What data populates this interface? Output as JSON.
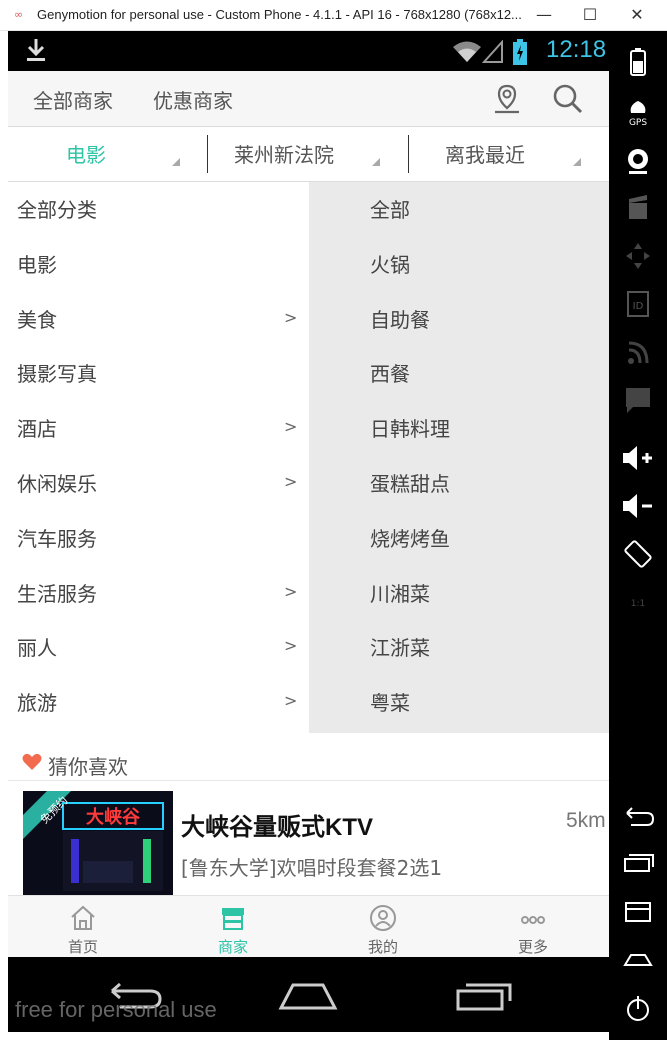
{
  "window": {
    "title": "Genymotion for personal use - Custom Phone - 4.1.1 - API 16 - 768x1280 (768x12...",
    "minimize": "—",
    "maximize": "☐",
    "close": "✕"
  },
  "statusbar": {
    "time": "12:18"
  },
  "topbar": {
    "tabs": [
      {
        "label": "全部商家"
      },
      {
        "label": "优惠商家"
      }
    ]
  },
  "filters": [
    {
      "label": "电影",
      "active": true
    },
    {
      "label": "莱州新法院",
      "active": false
    },
    {
      "label": "离我最近",
      "active": false
    }
  ],
  "categories": [
    {
      "label": "全部分类",
      "arrow": ""
    },
    {
      "label": "电影",
      "arrow": ""
    },
    {
      "label": "美食",
      "arrow": ">"
    },
    {
      "label": "摄影写真",
      "arrow": ""
    },
    {
      "label": "酒店",
      "arrow": ">"
    },
    {
      "label": "休闲娱乐",
      "arrow": ">"
    },
    {
      "label": "汽车服务",
      "arrow": ""
    },
    {
      "label": "生活服务",
      "arrow": ">"
    },
    {
      "label": "丽人",
      "arrow": ">"
    },
    {
      "label": "旅游",
      "arrow": ">"
    }
  ],
  "subcategories": [
    {
      "label": "全部"
    },
    {
      "label": "火锅"
    },
    {
      "label": "自助餐"
    },
    {
      "label": "西餐"
    },
    {
      "label": "日韩料理"
    },
    {
      "label": "蛋糕甜点"
    },
    {
      "label": "烧烤烤鱼"
    },
    {
      "label": "川湘菜"
    },
    {
      "label": "江浙菜"
    },
    {
      "label": "粤菜"
    }
  ],
  "recommend": {
    "title": "猜你喜欢",
    "item": {
      "name": "大峡谷量贩式KTV",
      "distance": "5km",
      "description": "[鲁东大学]欢唱时段套餐2选1",
      "badge": "免预约",
      "sign": "大峡谷"
    }
  },
  "bottomnav": [
    {
      "label": "首页",
      "icon": "home-icon",
      "active": false
    },
    {
      "label": "商家",
      "icon": "store-icon",
      "active": true
    },
    {
      "label": "我的",
      "icon": "profile-icon",
      "active": false
    },
    {
      "label": "更多",
      "icon": "more-icon",
      "active": false
    }
  ],
  "watermark": "free for personal use",
  "colors": {
    "accent": "#2ec4a6",
    "status_clock": "#3ec4e6",
    "heart": "#f26b4f",
    "badge": "#2ab0a0",
    "panel_gray": "#eaeaea"
  }
}
